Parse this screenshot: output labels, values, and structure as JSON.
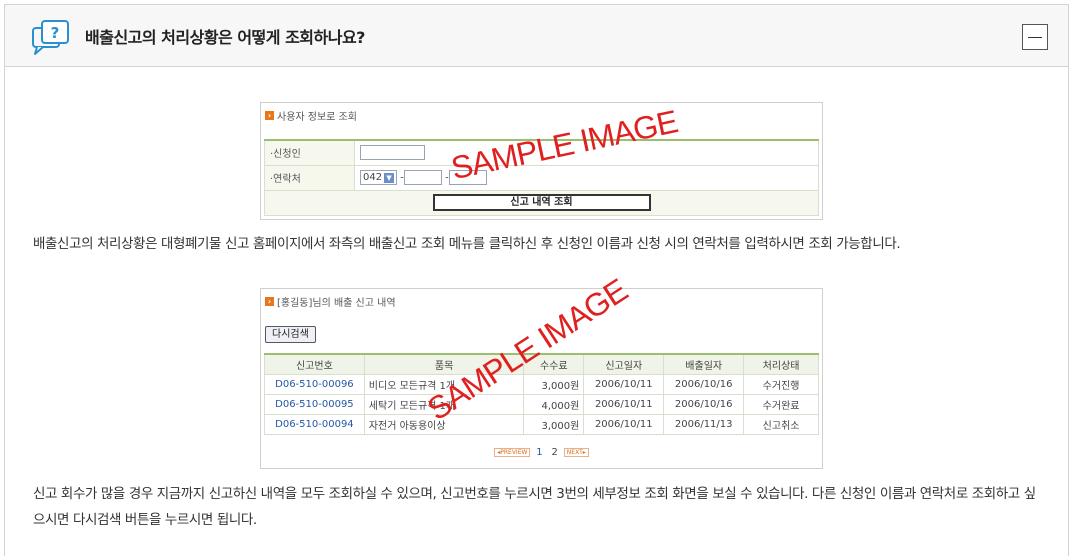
{
  "faq": {
    "title": "배출신고의 처리상황은 어떻게 조회하나요?",
    "description1": "배출신고의 처리상황은 대형폐기물 신고 홈페이지에서 좌측의 배출신고 조회 메뉴를 클릭하신 후 신청인 이름과 신청 시의 연락처를 입력하시면 조회 가능합니다.",
    "description2": "신고 회수가 많을 경우 지금까지 신고하신 내역을 모두 조회하실 수 있으며, 신고번호를 누르시면 3번의 세부정보 조회 화면을 보실 수 있습니다. 다른 신청인 이름과 연락처로 조회하고 싶으시면 다시검색 버튼을 누르시면 됩니다."
  },
  "sample1": {
    "section_title": "사용자 정보로 조회",
    "label_applicant": "·신청인",
    "label_contact": "·연락처",
    "area_code": "042",
    "search_button": "신고 내역 조회",
    "watermark": "SAMPLE IMAGE"
  },
  "sample2": {
    "section_title": "[홍길동]님의 배출 신고 내역",
    "retry_button": "다시검색",
    "columns": [
      "신고번호",
      "품목",
      "수수료",
      "신고일자",
      "배출일자",
      "처리상태"
    ],
    "rows": [
      {
        "no": "D06-510-00096",
        "item": "비디오 모든규격 1개",
        "fee": "3,000원",
        "reported": "2006/10/11",
        "disposal": "2006/10/16",
        "status": "수거진행"
      },
      {
        "no": "D06-510-00095",
        "item": "세탁기 모든규격 1개",
        "fee": "4,000원",
        "reported": "2006/10/11",
        "disposal": "2006/10/16",
        "status": "수거완료"
      },
      {
        "no": "D06-510-00094",
        "item": "자전거 아동용이상",
        "fee": "3,000원",
        "reported": "2006/10/11",
        "disposal": "2006/11/13",
        "status": "신고취소"
      }
    ],
    "pager": {
      "prev": "◂PREVIEW",
      "pages": [
        "1",
        "2"
      ],
      "next": "NEXT▸"
    },
    "watermark": "SAMPLE IMAGE"
  },
  "colors": {
    "accent_green": "#9cbf6f",
    "icon_blue": "#2a8fd1",
    "watermark_red": "#e02020",
    "badge_orange": "#e8761a"
  }
}
